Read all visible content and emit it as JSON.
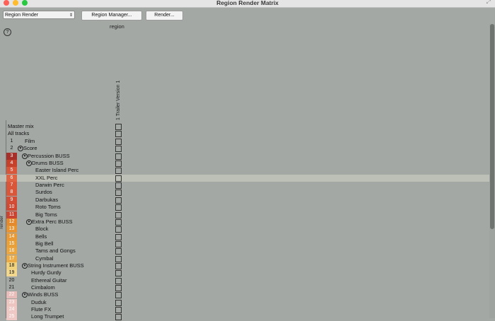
{
  "window": {
    "title": "Region Render Matrix"
  },
  "toolbar": {
    "dropdown_value": "Region Render",
    "region_manager_label": "Region Manager...",
    "render_label": "Render..."
  },
  "help_label": "?",
  "matrix": {
    "region_header": "region",
    "column_label": "1  Trailer Version 1",
    "render_axis_label": "render",
    "special_rows": [
      "Master mix",
      "All tracks"
    ]
  },
  "tracks": [
    {
      "num": "1",
      "name": "Film",
      "depth": 0,
      "folder": false,
      "color": ""
    },
    {
      "num": "2",
      "name": "Score",
      "depth": 0,
      "folder": true,
      "color": ""
    },
    {
      "num": "3",
      "name": "Percussion BUSS",
      "depth": 1,
      "folder": true,
      "color": "#a5302a"
    },
    {
      "num": "4",
      "name": "Drums BUSS",
      "depth": 2,
      "folder": true,
      "color": "#c4412c"
    },
    {
      "num": "5",
      "name": "Easter Island Perc",
      "depth": 3,
      "folder": false,
      "color": "#d8573b"
    },
    {
      "num": "6",
      "name": "XXL Perc",
      "depth": 3,
      "folder": false,
      "color": "#df6443"
    },
    {
      "num": "7",
      "name": "Darwin Perc",
      "depth": 3,
      "folder": false,
      "color": "#d8573b"
    },
    {
      "num": "8",
      "name": "Surdos",
      "depth": 3,
      "folder": false,
      "color": "#d8573b"
    },
    {
      "num": "9",
      "name": "Darbukas",
      "depth": 3,
      "folder": false,
      "color": "#d24d35"
    },
    {
      "num": "10",
      "name": "Roto Toms",
      "depth": 3,
      "folder": false,
      "color": "#cf4a33"
    },
    {
      "num": "11",
      "name": "Big Toms",
      "depth": 3,
      "folder": false,
      "color": "#c94531"
    },
    {
      "num": "12",
      "name": "Extra Perc BUSS",
      "depth": 2,
      "folder": true,
      "color": "#e48a2e"
    },
    {
      "num": "13",
      "name": "Block",
      "depth": 3,
      "folder": false,
      "color": "#e79533"
    },
    {
      "num": "14",
      "name": "Bells",
      "depth": 3,
      "folder": false,
      "color": "#e89a36"
    },
    {
      "num": "15",
      "name": "Big Bell",
      "depth": 3,
      "folder": false,
      "color": "#e8a03b"
    },
    {
      "num": "16",
      "name": "Tams and Gongs",
      "depth": 3,
      "folder": false,
      "color": "#eaa640"
    },
    {
      "num": "17",
      "name": "Cymbal",
      "depth": 3,
      "folder": false,
      "color": "#ebab47"
    },
    {
      "num": "18",
      "name": "String Instrument BUSS",
      "depth": 1,
      "folder": true,
      "color": "#f0d27e"
    },
    {
      "num": "19",
      "name": "Hurdy Gurdy",
      "depth": 2,
      "folder": false,
      "color": "#f2d88f"
    },
    {
      "num": "20",
      "name": "Ethereal Guitar",
      "depth": 2,
      "folder": false,
      "color": ""
    },
    {
      "num": "21",
      "name": "Cimbalom",
      "depth": 2,
      "folder": false,
      "color": ""
    },
    {
      "num": "22",
      "name": "Winds BUSS",
      "depth": 1,
      "folder": true,
      "color": "#e8bcb8"
    },
    {
      "num": "23",
      "name": "Duduk",
      "depth": 2,
      "folder": false,
      "color": "#ecc4c0"
    },
    {
      "num": "24",
      "name": "Flute FX",
      "depth": 2,
      "folder": false,
      "color": "#eec8c4"
    },
    {
      "num": "25",
      "name": "Long Trumpet",
      "depth": 2,
      "folder": false,
      "color": "#eec8c4"
    }
  ],
  "selected_track": "6"
}
